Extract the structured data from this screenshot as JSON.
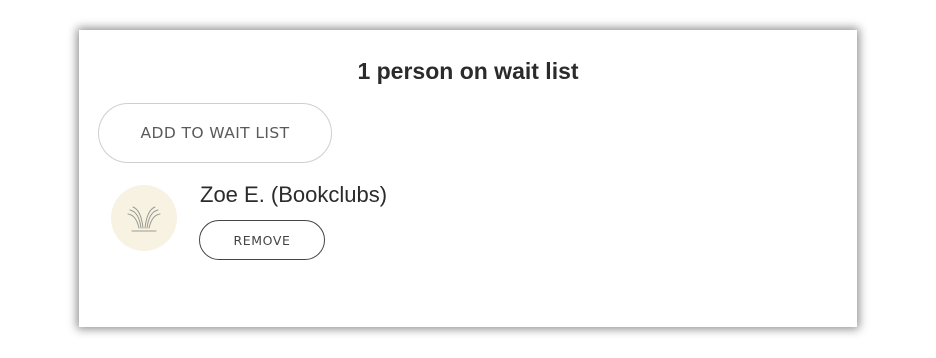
{
  "waitlist": {
    "title": "1 person on wait list",
    "add_button_label": "ADD TO WAIT LIST",
    "members": [
      {
        "name": "Zoe E. (Bookclubs)",
        "avatar_icon": "bookclubs-logo-icon",
        "remove_label": "REMOVE"
      }
    ]
  },
  "colors": {
    "avatar_bg": "#f8f2e3",
    "text": "#2b2b2b",
    "button_border_light": "#cfcfcf",
    "button_border_dark": "#444444"
  }
}
